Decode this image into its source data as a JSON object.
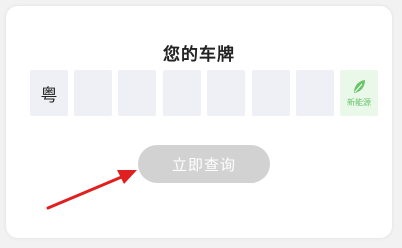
{
  "card": {
    "title": "您的车牌"
  },
  "plate": {
    "province": "粤",
    "empty_cells": 7,
    "new_energy_label": "新能源",
    "new_energy_icon": "leaf-icon"
  },
  "query_button": {
    "label": "立即查询"
  },
  "colors": {
    "annotation_arrow": "#e02020",
    "button_disabled": "#d2d2d2",
    "new_energy_green": "#67c467"
  }
}
